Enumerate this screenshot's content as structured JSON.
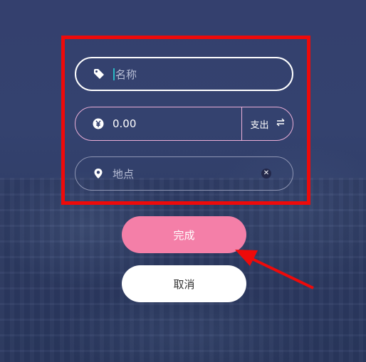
{
  "form": {
    "name": {
      "placeholder": "名称",
      "icon": "tag-icon"
    },
    "amount": {
      "value": "0.00",
      "icon": "yen-icon",
      "type_label": "支出",
      "toggle_icon": "swap-arrows-icon"
    },
    "place": {
      "placeholder": "地点",
      "icon": "location-pin-icon",
      "clear_icon": "clear-icon"
    }
  },
  "buttons": {
    "done_label": "完成",
    "cancel_label": "取消"
  },
  "colors": {
    "background": "#344170",
    "done_button": "#f47fa8",
    "annotation": "#ee0a0a",
    "caret": "#29b8c4"
  }
}
